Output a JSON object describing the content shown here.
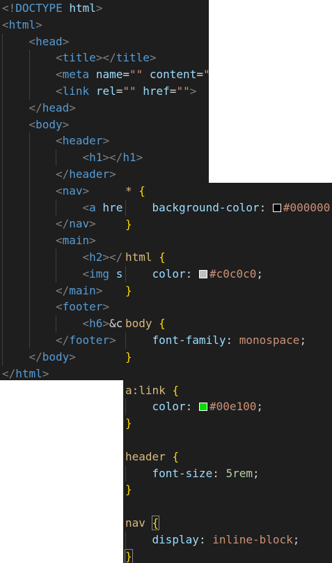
{
  "html_editor": {
    "lines": [
      {
        "indent": 0,
        "tokens": [
          {
            "t": "<!",
            "c": "punct"
          },
          {
            "t": "DOCTYPE",
            "c": "tag"
          },
          {
            "t": " ",
            "c": "plain"
          },
          {
            "t": "html",
            "c": "attr"
          },
          {
            "t": ">",
            "c": "punct"
          }
        ]
      },
      {
        "indent": 0,
        "tokens": [
          {
            "t": "<",
            "c": "punct"
          },
          {
            "t": "html",
            "c": "tag"
          },
          {
            "t": ">",
            "c": "punct"
          }
        ]
      },
      {
        "indent": 1,
        "tokens": [
          {
            "t": "<",
            "c": "punct"
          },
          {
            "t": "head",
            "c": "tag"
          },
          {
            "t": ">",
            "c": "punct"
          }
        ]
      },
      {
        "indent": 2,
        "tokens": [
          {
            "t": "<",
            "c": "punct"
          },
          {
            "t": "title",
            "c": "tag"
          },
          {
            "t": "></",
            "c": "punct"
          },
          {
            "t": "title",
            "c": "tag"
          },
          {
            "t": ">",
            "c": "punct"
          }
        ]
      },
      {
        "indent": 2,
        "tokens": [
          {
            "t": "<",
            "c": "punct"
          },
          {
            "t": "meta",
            "c": "tag"
          },
          {
            "t": " ",
            "c": "plain"
          },
          {
            "t": "name",
            "c": "attr"
          },
          {
            "t": "=",
            "c": "plain"
          },
          {
            "t": "\"\"",
            "c": "str"
          },
          {
            "t": " ",
            "c": "plain"
          },
          {
            "t": "content",
            "c": "attr"
          },
          {
            "t": "=",
            "c": "plain"
          },
          {
            "t": "\"",
            "c": "str"
          }
        ]
      },
      {
        "indent": 2,
        "tokens": [
          {
            "t": "<",
            "c": "punct"
          },
          {
            "t": "link",
            "c": "tag"
          },
          {
            "t": " ",
            "c": "plain"
          },
          {
            "t": "rel",
            "c": "attr"
          },
          {
            "t": "=",
            "c": "plain"
          },
          {
            "t": "\"\"",
            "c": "str"
          },
          {
            "t": " ",
            "c": "plain"
          },
          {
            "t": "href",
            "c": "attr"
          },
          {
            "t": "=",
            "c": "plain"
          },
          {
            "t": "\"\"",
            "c": "str"
          },
          {
            "t": ">",
            "c": "punct"
          }
        ]
      },
      {
        "indent": 1,
        "tokens": [
          {
            "t": "</",
            "c": "punct"
          },
          {
            "t": "head",
            "c": "tag"
          },
          {
            "t": ">",
            "c": "punct"
          }
        ]
      },
      {
        "indent": 1,
        "tokens": [
          {
            "t": "<",
            "c": "punct"
          },
          {
            "t": "body",
            "c": "tag"
          },
          {
            "t": ">",
            "c": "punct"
          }
        ]
      },
      {
        "indent": 2,
        "tokens": [
          {
            "t": "<",
            "c": "punct"
          },
          {
            "t": "header",
            "c": "tag"
          },
          {
            "t": ">",
            "c": "punct"
          }
        ]
      },
      {
        "indent": 3,
        "tokens": [
          {
            "t": "<",
            "c": "punct"
          },
          {
            "t": "h1",
            "c": "tag"
          },
          {
            "t": "></",
            "c": "punct"
          },
          {
            "t": "h1",
            "c": "tag"
          },
          {
            "t": ">",
            "c": "punct"
          }
        ]
      },
      {
        "indent": 2,
        "tokens": [
          {
            "t": "</",
            "c": "punct"
          },
          {
            "t": "header",
            "c": "tag"
          },
          {
            "t": ">",
            "c": "punct"
          }
        ]
      },
      {
        "indent": 2,
        "tokens": [
          {
            "t": "<",
            "c": "punct"
          },
          {
            "t": "nav",
            "c": "tag"
          },
          {
            "t": ">",
            "c": "punct"
          }
        ]
      },
      {
        "indent": 3,
        "tokens": [
          {
            "t": "<",
            "c": "punct"
          },
          {
            "t": "a",
            "c": "tag"
          },
          {
            "t": " ",
            "c": "plain"
          },
          {
            "t": "hre",
            "c": "attr"
          }
        ]
      },
      {
        "indent": 2,
        "tokens": [
          {
            "t": "</",
            "c": "punct"
          },
          {
            "t": "nav",
            "c": "tag"
          },
          {
            "t": ">",
            "c": "punct"
          }
        ]
      },
      {
        "indent": 2,
        "tokens": [
          {
            "t": "<",
            "c": "punct"
          },
          {
            "t": "main",
            "c": "tag"
          },
          {
            "t": ">",
            "c": "punct"
          }
        ]
      },
      {
        "indent": 3,
        "tokens": [
          {
            "t": "<",
            "c": "punct"
          },
          {
            "t": "h2",
            "c": "tag"
          },
          {
            "t": "></",
            "c": "punct"
          }
        ]
      },
      {
        "indent": 3,
        "tokens": [
          {
            "t": "<",
            "c": "punct"
          },
          {
            "t": "img",
            "c": "tag"
          },
          {
            "t": " ",
            "c": "plain"
          },
          {
            "t": "s",
            "c": "attr"
          }
        ]
      },
      {
        "indent": 2,
        "tokens": [
          {
            "t": "</",
            "c": "punct"
          },
          {
            "t": "main",
            "c": "tag"
          },
          {
            "t": ">",
            "c": "punct"
          }
        ]
      },
      {
        "indent": 2,
        "tokens": [
          {
            "t": "<",
            "c": "punct"
          },
          {
            "t": "footer",
            "c": "tag"
          },
          {
            "t": ">",
            "c": "punct"
          }
        ]
      },
      {
        "indent": 3,
        "tokens": [
          {
            "t": "<",
            "c": "punct"
          },
          {
            "t": "h6",
            "c": "tag"
          },
          {
            "t": ">",
            "c": "punct"
          },
          {
            "t": "&c",
            "c": "text"
          }
        ]
      },
      {
        "indent": 2,
        "tokens": [
          {
            "t": "</",
            "c": "punct"
          },
          {
            "t": "footer",
            "c": "tag"
          },
          {
            "t": ">",
            "c": "punct"
          }
        ]
      },
      {
        "indent": 1,
        "tokens": [
          {
            "t": "</",
            "c": "punct"
          },
          {
            "t": "body",
            "c": "tag"
          },
          {
            "t": ">",
            "c": "punct"
          }
        ]
      },
      {
        "indent": 0,
        "tokens": [
          {
            "t": "</",
            "c": "punct"
          },
          {
            "t": "html",
            "c": "tag"
          },
          {
            "t": ">",
            "c": "punct"
          }
        ]
      }
    ]
  },
  "css_editor": {
    "lines": [
      {
        "indent": 0,
        "tokens": [
          {
            "t": "*",
            "c": "sel"
          },
          {
            "t": " ",
            "c": "plain"
          },
          {
            "t": "{",
            "c": "brace"
          }
        ]
      },
      {
        "indent": 1,
        "tokens": [
          {
            "t": "background-color",
            "c": "prop"
          },
          {
            "t": ": ",
            "c": "plain"
          },
          {
            "swatch": "#000000"
          },
          {
            "t": "#000000",
            "c": "val"
          }
        ]
      },
      {
        "indent": 0,
        "tokens": [
          {
            "t": "}",
            "c": "brace"
          }
        ]
      },
      {
        "indent": 0,
        "tokens": []
      },
      {
        "indent": 0,
        "tokens": [
          {
            "t": "html",
            "c": "sel"
          },
          {
            "t": " ",
            "c": "plain"
          },
          {
            "t": "{",
            "c": "brace"
          }
        ]
      },
      {
        "indent": 1,
        "tokens": [
          {
            "t": "color",
            "c": "prop"
          },
          {
            "t": ": ",
            "c": "plain"
          },
          {
            "swatch": "#c0c0c0"
          },
          {
            "t": "#c0c0c0",
            "c": "val"
          },
          {
            "t": ";",
            "c": "plain"
          }
        ]
      },
      {
        "indent": 0,
        "tokens": [
          {
            "t": "}",
            "c": "brace"
          }
        ]
      },
      {
        "indent": 0,
        "tokens": []
      },
      {
        "indent": 0,
        "tokens": [
          {
            "t": "body",
            "c": "sel"
          },
          {
            "t": " ",
            "c": "plain"
          },
          {
            "t": "{",
            "c": "brace"
          }
        ]
      },
      {
        "indent": 1,
        "tokens": [
          {
            "t": "font-family",
            "c": "prop"
          },
          {
            "t": ": ",
            "c": "plain"
          },
          {
            "t": "monospace",
            "c": "val"
          },
          {
            "t": ";",
            "c": "plain"
          }
        ]
      },
      {
        "indent": 0,
        "tokens": [
          {
            "t": "}",
            "c": "brace"
          }
        ]
      },
      {
        "indent": 0,
        "tokens": []
      },
      {
        "indent": 0,
        "tokens": [
          {
            "t": "a:link",
            "c": "sel"
          },
          {
            "t": " ",
            "c": "plain"
          },
          {
            "t": "{",
            "c": "brace"
          }
        ]
      },
      {
        "indent": 1,
        "tokens": [
          {
            "t": "color",
            "c": "prop"
          },
          {
            "t": ": ",
            "c": "plain"
          },
          {
            "swatch": "#00e100"
          },
          {
            "t": "#00e100",
            "c": "val"
          },
          {
            "t": ";",
            "c": "plain"
          }
        ]
      },
      {
        "indent": 0,
        "tokens": [
          {
            "t": "}",
            "c": "brace"
          }
        ]
      },
      {
        "indent": 0,
        "tokens": []
      },
      {
        "indent": 0,
        "tokens": [
          {
            "t": "header",
            "c": "sel"
          },
          {
            "t": " ",
            "c": "plain"
          },
          {
            "t": "{",
            "c": "brace"
          }
        ]
      },
      {
        "indent": 1,
        "tokens": [
          {
            "t": "font-size",
            "c": "prop"
          },
          {
            "t": ": ",
            "c": "plain"
          },
          {
            "t": "5rem",
            "c": "num"
          },
          {
            "t": ";",
            "c": "plain"
          }
        ]
      },
      {
        "indent": 0,
        "tokens": [
          {
            "t": "}",
            "c": "brace"
          }
        ]
      },
      {
        "indent": 0,
        "tokens": []
      },
      {
        "indent": 0,
        "tokens": [
          {
            "t": "nav",
            "c": "sel"
          },
          {
            "t": " ",
            "c": "plain"
          },
          {
            "t": "{",
            "c": "brace",
            "match": true
          }
        ]
      },
      {
        "indent": 1,
        "tokens": [
          {
            "t": "display",
            "c": "prop"
          },
          {
            "t": ": ",
            "c": "plain"
          },
          {
            "t": "inline-block",
            "c": "val"
          },
          {
            "t": ";",
            "c": "plain"
          }
        ]
      },
      {
        "indent": 0,
        "tokens": [
          {
            "t": "}",
            "c": "brace",
            "match": true
          }
        ]
      }
    ]
  }
}
